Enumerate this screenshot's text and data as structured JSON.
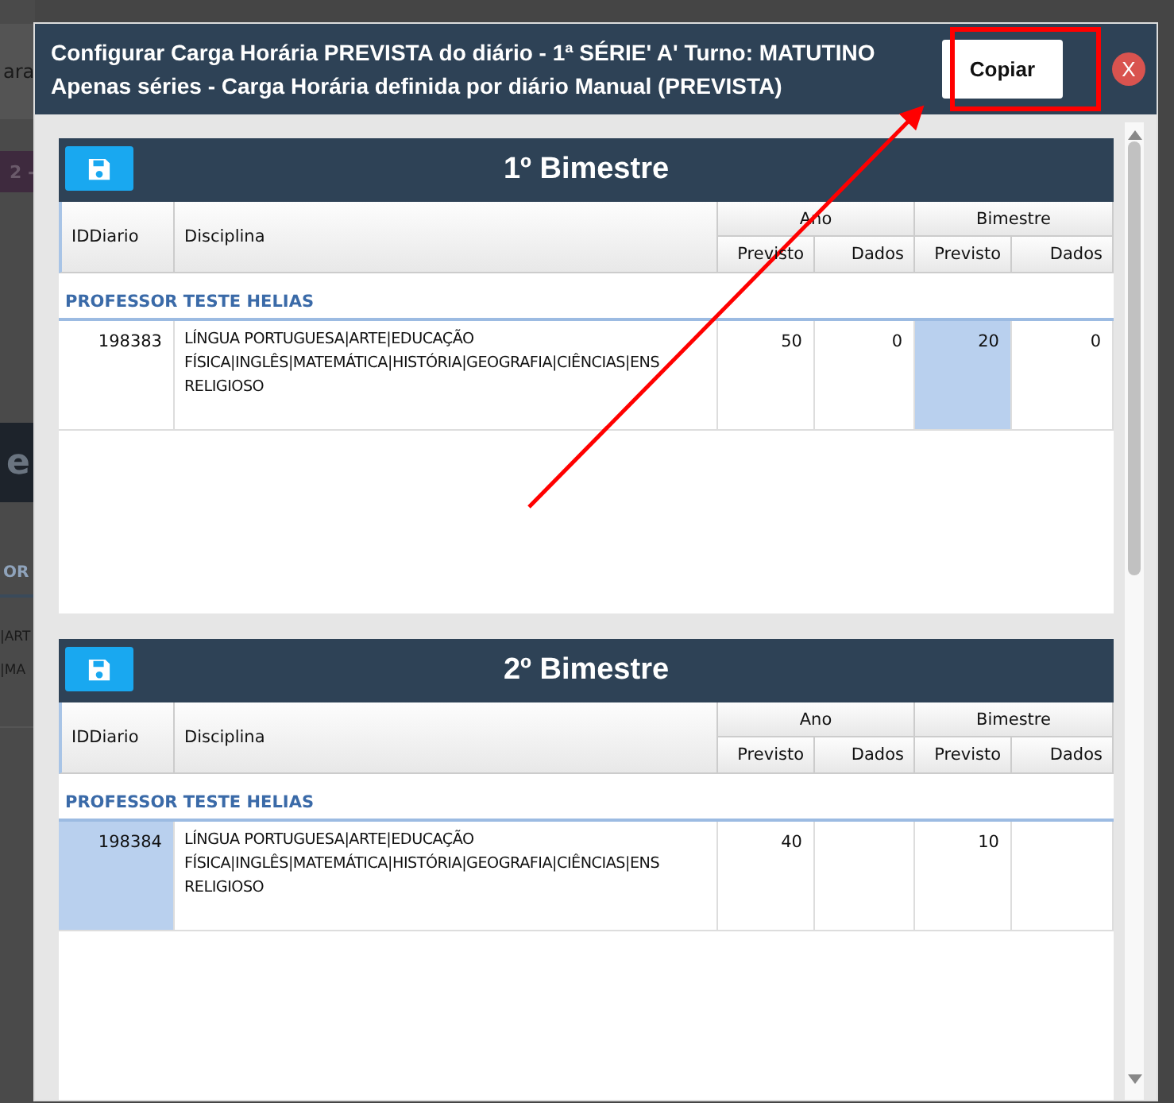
{
  "background": [
    {
      "kind": "header",
      "text": "ara"
    },
    {
      "kind": "purple-bar",
      "text": "2 -"
    },
    {
      "kind": "dark-band",
      "text": "e"
    },
    {
      "kind": "tab",
      "text": "OR"
    },
    {
      "kind": "lines",
      "lines": [
        "|ART",
        "|MA"
      ]
    }
  ],
  "dialog": {
    "title_lines": [
      "Configurar Carga Horária PREVISTA do diário - 1ª SÉRIE' A' Turno: MATUTINO",
      "Apenas séries - Carga Horária definida por diário Manual (PREVISTA)"
    ],
    "copy_button": "Copiar",
    "close_button": "X"
  },
  "panels": [
    {
      "title": "1º Bimestre",
      "columns": {
        "id": "IDDiario",
        "subject": "Disciplina",
        "group_1": "Ano",
        "group_2": "Bimestre",
        "sub": [
          "Previsto",
          "Dados",
          "Previsto",
          "Dados"
        ]
      },
      "teacher": "PROFESSOR TESTE HELIAS",
      "rows": [
        {
          "cells": [
            {
              "text": "198383",
              "highlighted": false
            },
            {
              "lines": [
                "LÍNGUA PORTUGUESA|ARTE|EDUCAÇÃO",
                "FÍSICA|INGLÊS|MATEMÁTICA|HISTÓRIA|GEOGRAFIA|CIÊNCIAS|ENS",
                "RELIGIOSO"
              ],
              "highlighted": false
            },
            {
              "text": "50",
              "highlighted": false
            },
            {
              "text": "0",
              "highlighted": false
            },
            {
              "text": "20",
              "highlighted": true
            },
            {
              "text": "0",
              "highlighted": false
            }
          ]
        }
      ]
    },
    {
      "title": "2º Bimestre",
      "columns": {
        "id": "IDDiario",
        "subject": "Disciplina",
        "group_1": "Ano",
        "group_2": "Bimestre",
        "sub": [
          "Previsto",
          "Dados",
          "Previsto",
          "Dados"
        ]
      },
      "teacher": "PROFESSOR TESTE HELIAS",
      "rows": [
        {
          "cells": [
            {
              "text": "198384",
              "highlighted": true
            },
            {
              "lines": [
                "LÍNGUA PORTUGUESA|ARTE|EDUCAÇÃO",
                "FÍSICA|INGLÊS|MATEMÁTICA|HISTÓRIA|GEOGRAFIA|CIÊNCIAS|ENS",
                "RELIGIOSO"
              ],
              "highlighted": false
            },
            {
              "text": "40",
              "highlighted": false
            },
            {
              "highlighted": false
            },
            {
              "text": "10",
              "highlighted": false
            },
            {
              "highlighted": false
            }
          ]
        }
      ]
    }
  ],
  "annotations": {
    "copy_button_frame": true,
    "arrow_to_copy": true
  }
}
